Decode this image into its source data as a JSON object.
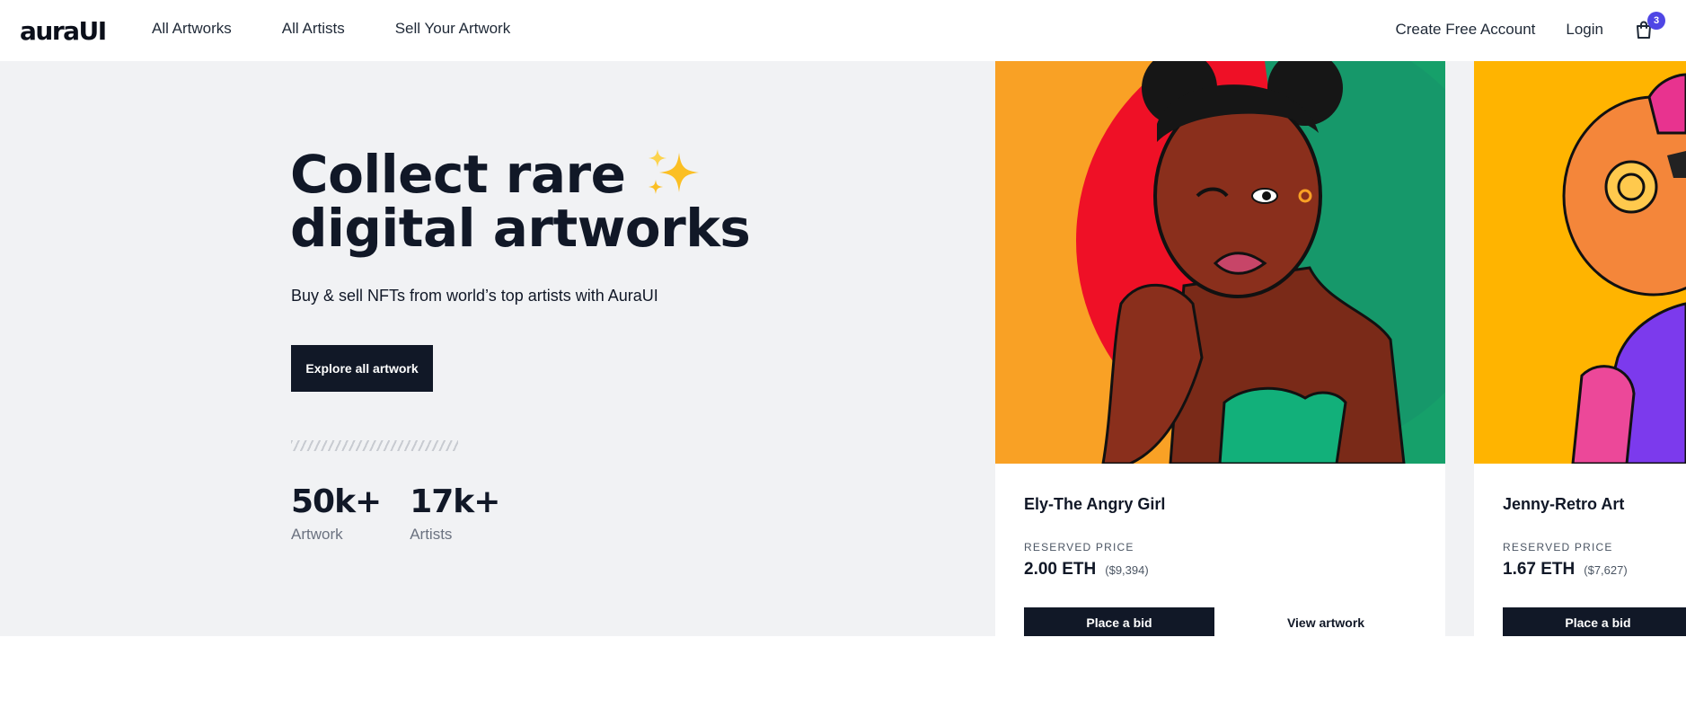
{
  "nav": {
    "logo": "auraUI",
    "links": [
      "All Artworks",
      "All Artists",
      "Sell Your Artwork"
    ],
    "create_account": "Create Free Account",
    "login": "Login",
    "cart_icon": "shopping-bag-icon",
    "cart_count": "3",
    "badge_color": "#4f46e5"
  },
  "hero": {
    "title_line1": "Collect rare",
    "title_line2": "digital artworks",
    "subtitle": "Buy & sell NFTs from world’s top artists with AuraUI",
    "cta": "Explore all artwork",
    "stats": [
      {
        "value": "50k+",
        "label": "Artwork"
      },
      {
        "value": "17k+",
        "label": "Artists"
      }
    ]
  },
  "cards": [
    {
      "title": "Ely-The Angry Girl",
      "price_label": "RESERVED PRICE",
      "price_eth": "2.00 ETH",
      "price_usd": "($9,394)",
      "bid_label": "Place a bid",
      "view_label": "View artwork"
    },
    {
      "title": "Jenny-Retro Art",
      "price_label": "RESERVED PRICE",
      "price_eth": "1.67 ETH",
      "price_usd": "($7,627)",
      "bid_label": "Place a bid"
    }
  ],
  "colors": {
    "primary": "#111827",
    "hero_bg": "#f1f2f4",
    "card1_bg": "#f9a125",
    "card1_circle": "#ef1026",
    "card1_accent": "#0aa06e",
    "card2_bg": "#ffb400"
  }
}
